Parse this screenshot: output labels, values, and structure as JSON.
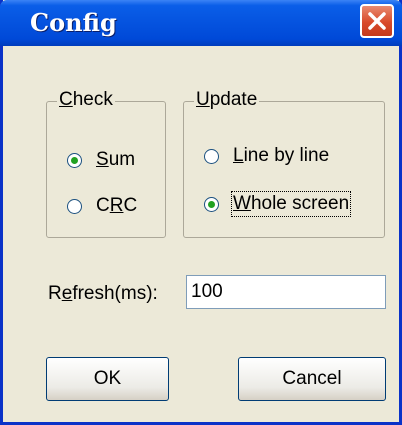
{
  "window": {
    "title": "Config"
  },
  "check": {
    "legend_u": "C",
    "legend_rest": "heck",
    "sum": {
      "pre": "",
      "u": "S",
      "post": "um",
      "selected": true
    },
    "crc": {
      "pre": "C",
      "u": "R",
      "post": "C",
      "selected": false
    }
  },
  "update": {
    "legend_u": "U",
    "legend_rest": "pdate",
    "line": {
      "pre": "",
      "u": "L",
      "post": "ine by line",
      "selected": false
    },
    "whole": {
      "pre": "",
      "u": "W",
      "post": "hole screen",
      "selected": true
    }
  },
  "refresh": {
    "label_pre": "R",
    "label_u": "e",
    "label_post": "fresh(ms):",
    "value": "100"
  },
  "buttons": {
    "ok": "OK",
    "cancel": "Cancel"
  },
  "colors": {
    "title_bar": "#0553DF",
    "dialog_bg": "#ECE9D8",
    "close_button": "#D94A2A"
  }
}
